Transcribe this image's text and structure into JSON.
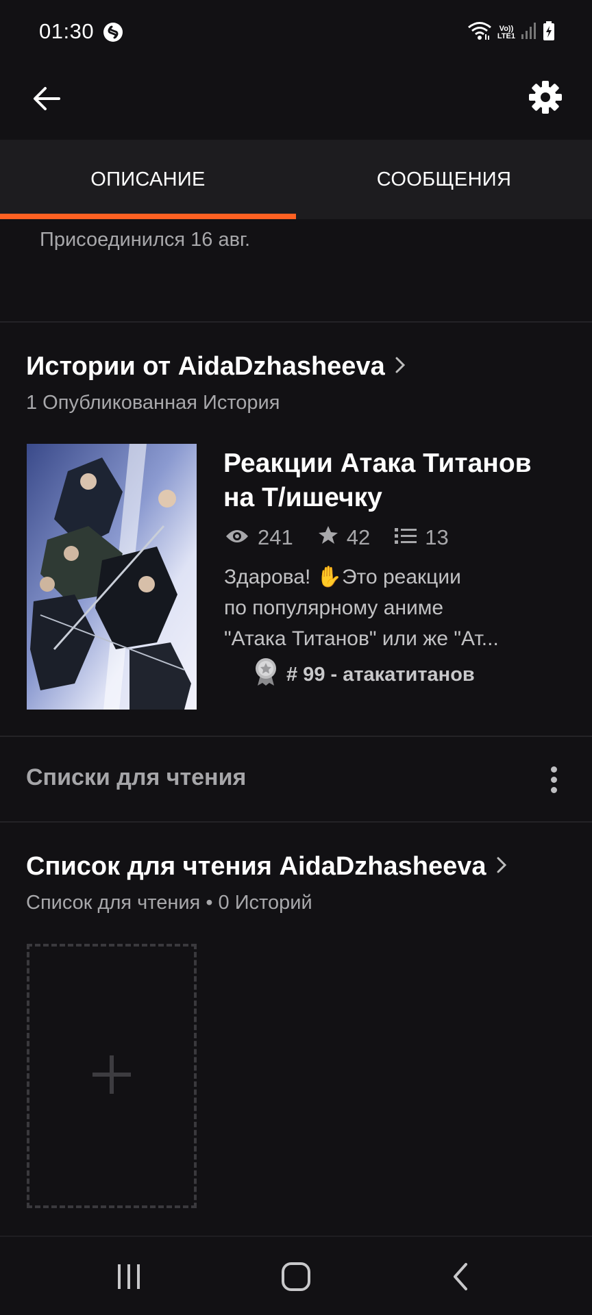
{
  "status_bar": {
    "time": "01:30",
    "network_label_top": "Vo))",
    "network_label_bottom": "LTE1",
    "icons": [
      "shazam-icon",
      "wifi-icon",
      "signal-icon",
      "battery-charging-icon"
    ]
  },
  "app_bar": {
    "back_icon": "arrow-left-icon",
    "settings_icon": "gear-icon"
  },
  "tabs": [
    {
      "label": "ОПИСАНИЕ",
      "active": true
    },
    {
      "label": "СООБЩЕНИЯ",
      "active": false
    }
  ],
  "profile": {
    "joined": "Присоединился 16 авг."
  },
  "stories_section": {
    "title": "Истории от AidaDzhasheeva",
    "subtitle": "1 Опубликованная История"
  },
  "story": {
    "title": "Реакции Атака Титанов на Т/ишечку",
    "views": "241",
    "votes": "42",
    "parts": "13",
    "description_line1": "Здарова! ✋Это реакции",
    "description_line2": "по популярному аниме",
    "description_line3": "\"Атака Титанов\"  или же \"Ат...",
    "rank": "# 99 - атакатитанов"
  },
  "reading_lists_row": {
    "label": "Списки для чтения"
  },
  "reading_list": {
    "title": "Список для чтения AidaDzhasheeva",
    "subtitle": "Список для чтения • 0 Историй"
  },
  "colors": {
    "accent": "#ff6122",
    "background": "#121114",
    "tab_background": "#1d1c1f"
  }
}
